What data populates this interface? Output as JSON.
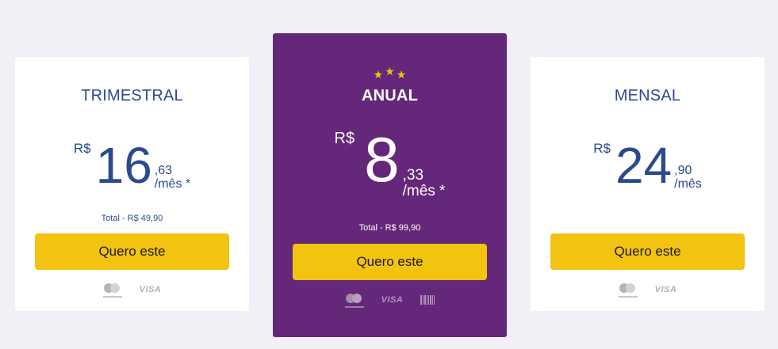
{
  "plans": [
    {
      "title": "TRIMESTRAL",
      "currency": "R$",
      "amount": "16",
      "cents": ",63",
      "period": "/mês *",
      "total": "Total - R$ 49,90",
      "button_label": "Quero este",
      "payment_methods": [
        "mastercard-icon",
        "visa-icon"
      ],
      "visa_text": "VISA"
    },
    {
      "title": "ANUAL",
      "featured": true,
      "stars": 3,
      "currency": "R$",
      "amount": "8",
      "cents": ",33",
      "period": "/mês *",
      "total": "Total - R$ 99,90",
      "button_label": "Quero este",
      "payment_methods": [
        "mastercard-icon",
        "visa-icon",
        "boleto-barcode-icon"
      ],
      "visa_text": "VISA"
    },
    {
      "title": "MENSAL",
      "currency": "R$",
      "amount": "24",
      "cents": ",90",
      "period": "/mês",
      "button_label": "Quero este",
      "payment_methods": [
        "mastercard-icon",
        "visa-icon"
      ],
      "visa_text": "VISA"
    }
  ],
  "colors": {
    "page_background": "#f3eff6",
    "featured_background": "#652779",
    "accent_button": "#f2c311",
    "price_text": "#2b4a8e",
    "star": "#f2c311"
  }
}
